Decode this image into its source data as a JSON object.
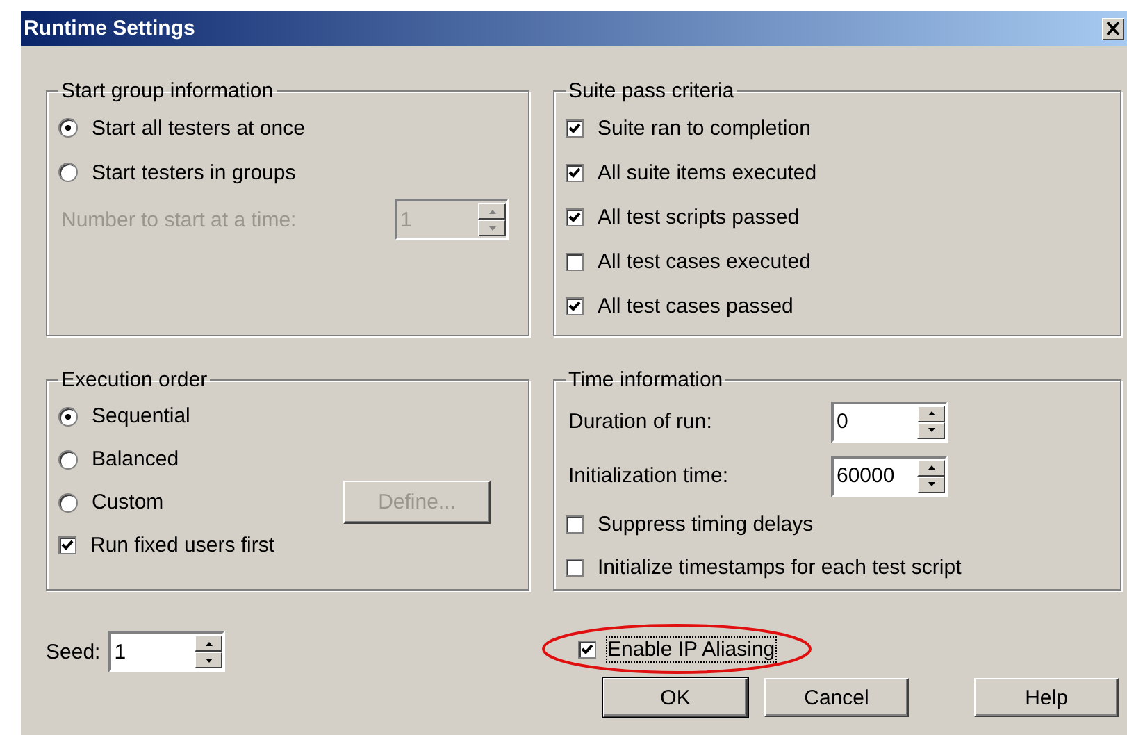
{
  "window": {
    "title": "Runtime Settings"
  },
  "start_group": {
    "title": "Start group information",
    "options": [
      {
        "label": "Start all testers at once",
        "selected": true
      },
      {
        "label": "Start testers in groups",
        "selected": false
      }
    ],
    "number_field": {
      "label": "Number to start at a time:",
      "value": "1",
      "disabled": true
    }
  },
  "suite_pass_criteria": {
    "title": "Suite pass criteria",
    "items": [
      {
        "label": "Suite ran to completion",
        "checked": true
      },
      {
        "label": "All suite items executed",
        "checked": true
      },
      {
        "label": "All test scripts passed",
        "checked": true
      },
      {
        "label": "All test cases executed",
        "checked": false
      },
      {
        "label": "All test cases passed",
        "checked": true
      }
    ]
  },
  "execution_order": {
    "title": "Execution order",
    "options": [
      {
        "label": "Sequential",
        "selected": true
      },
      {
        "label": "Balanced",
        "selected": false
      },
      {
        "label": "Custom",
        "selected": false
      }
    ],
    "define_button": {
      "label": "Define...",
      "disabled": true
    },
    "run_fixed_users_first": {
      "label": "Run fixed users first",
      "checked": true
    }
  },
  "time_information": {
    "title": "Time information",
    "fields": [
      {
        "label": "Duration of run:",
        "value": "0"
      },
      {
        "label": "Initialization time:",
        "value": "60000"
      }
    ],
    "checkboxes": [
      {
        "label": "Suppress timing delays",
        "checked": false
      },
      {
        "label": "Initialize timestamps for each test script",
        "checked": false
      }
    ]
  },
  "seed": {
    "label": "Seed:",
    "value": "1"
  },
  "enable_ip_aliasing": {
    "label": "Enable IP Aliasing",
    "checked": true,
    "highlighted": true
  },
  "buttons": [
    {
      "label": "OK",
      "default": true
    },
    {
      "label": "Cancel",
      "default": false
    },
    {
      "label": "Help",
      "default": false
    }
  ]
}
